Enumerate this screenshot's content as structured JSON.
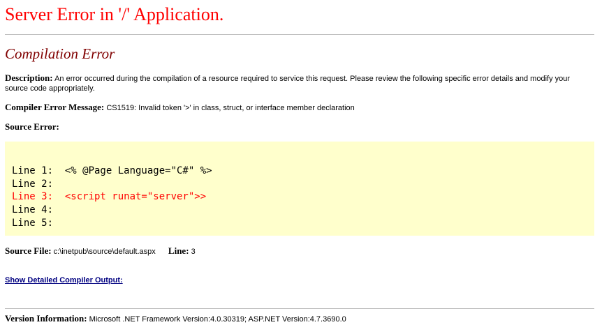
{
  "page": {
    "title": "Server Error in '/' Application.",
    "subtitle": "Compilation Error"
  },
  "description": {
    "label": "Description:",
    "text": "An error occurred during the compilation of a resource required to service this request. Please review the following specific error details and modify your source code appropriately."
  },
  "compiler_error": {
    "label": "Compiler Error Message:",
    "text": "CS1519: Invalid token '>' in class, struct, or interface member declaration"
  },
  "source_error": {
    "label": "Source Error:",
    "lines": [
      "Line 1:  <% @Page Language=\"C#\" %>",
      "Line 2:",
      "Line 3:  <script runat=\"server\">>",
      "Line 4:",
      "Line 5:"
    ],
    "error_line_index": 2
  },
  "source_file": {
    "label": "Source File:",
    "path": "c:\\inetpub\\source\\default.aspx",
    "line_label": "Line:",
    "line_value": "3"
  },
  "detail_link": "Show Detailed Compiler Output:",
  "version": {
    "label": "Version Information:",
    "text": "Microsoft .NET Framework Version:4.0.30319; ASP.NET Version:4.7.3690.0"
  },
  "colors": {
    "title": "#ff0000",
    "subtitle": "#800000",
    "code_background": "#ffffcc",
    "error_line": "#ff0000",
    "link": "#000080"
  }
}
